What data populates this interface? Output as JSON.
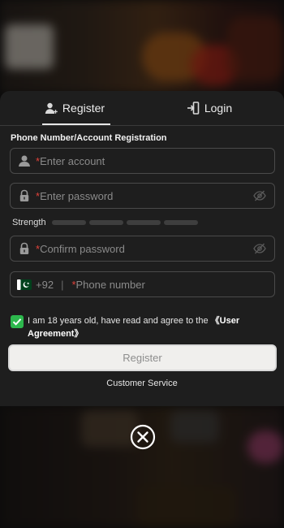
{
  "tabs": {
    "register_label": "Register",
    "login_label": "Login",
    "active": "register"
  },
  "form": {
    "section_title": "Phone Number/Account Registration",
    "required_mark": "*",
    "account_placeholder": "Enter account",
    "password_placeholder": "Enter password",
    "confirm_placeholder": "Confirm password",
    "phone_placeholder": "Phone number",
    "country_code": "+92",
    "separator": "|",
    "strength_label": "Strength"
  },
  "agreement": {
    "checked": true,
    "text": "I am 18 years old, have read and agree to the ",
    "link_text": "《User Agreement》"
  },
  "buttons": {
    "register_label": "Register",
    "customer_service_label": "Customer Service"
  },
  "icons": {
    "register_tab": "user-add-icon",
    "login_tab": "login-door-icon",
    "account": "user-icon",
    "password": "lock-icon",
    "visibility": "eye-off-icon",
    "flag": "pakistan-flag-icon",
    "checkbox": "check-icon",
    "close": "close-circle-icon"
  },
  "colors": {
    "required": "#e0423a",
    "checkbox": "#2db84d",
    "modal_bg": "#1e1e1e",
    "button_bg": "#f0efed"
  }
}
